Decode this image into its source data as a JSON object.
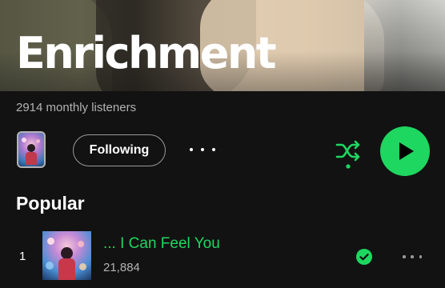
{
  "artist": {
    "name": "Enrichment",
    "monthly_listeners": "2914 monthly listeners"
  },
  "actions": {
    "follow_label": "Following",
    "more_icon": "more-horizontal-icon",
    "shuffle_icon": "shuffle-icon",
    "play_icon": "play-icon",
    "accent_color": "#1ed760"
  },
  "popular": {
    "section_title": "Popular",
    "tracks": [
      {
        "rank": "1",
        "title": "... I Can Feel You",
        "plays": "21,884",
        "saved_icon": "check-circle-icon",
        "more_icon": "more-horizontal-icon"
      }
    ]
  }
}
